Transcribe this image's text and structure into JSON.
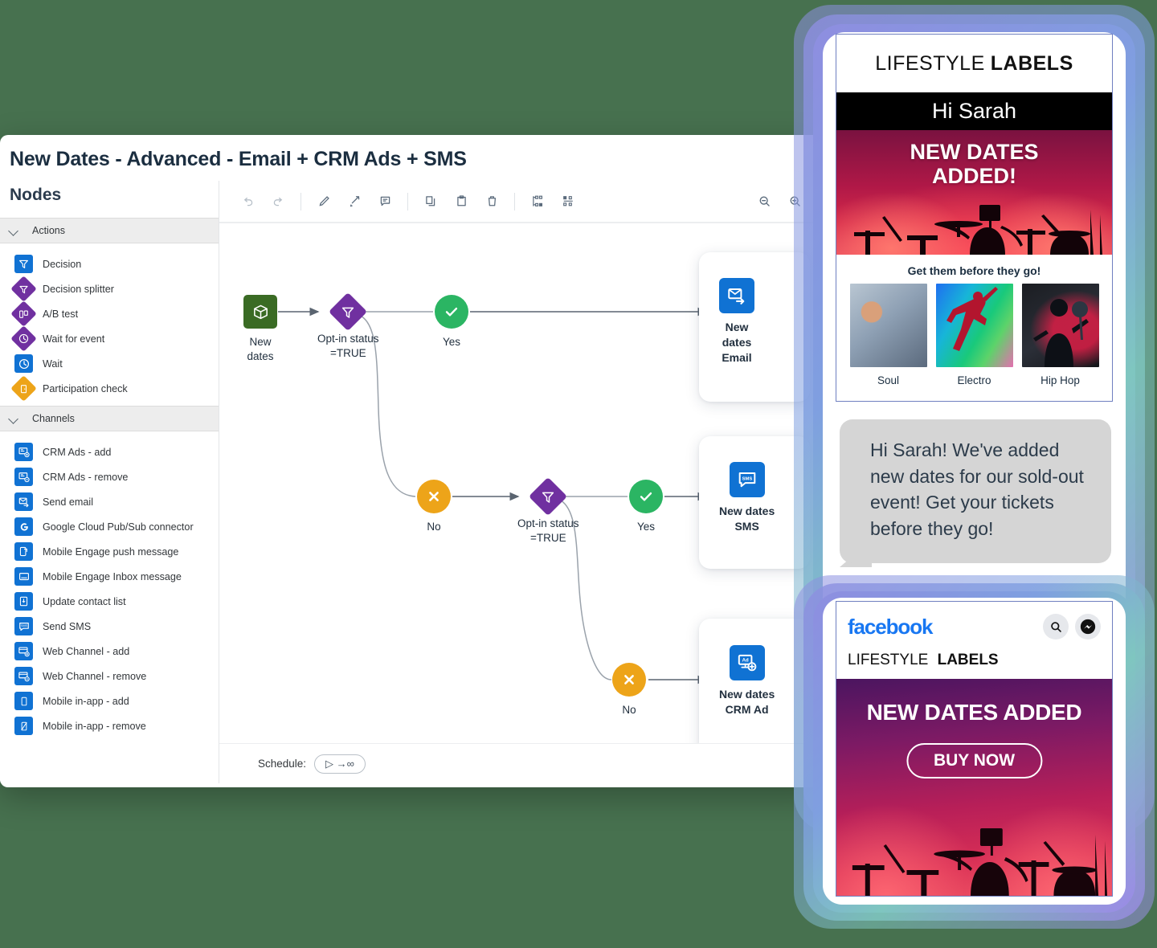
{
  "app": {
    "title": "New Dates - Advanced - Email + CRM Ads + SMS",
    "sidebar_title": "Nodes"
  },
  "sidebar": {
    "groups": [
      {
        "label": "Actions",
        "items": [
          {
            "label": "Decision",
            "icon": "funnel-square-icon",
            "shape": "square-blue"
          },
          {
            "label": "Decision splitter",
            "icon": "funnel-diamond-icon",
            "shape": "diamond-purple"
          },
          {
            "label": "A/B test",
            "icon": "ab-test-icon",
            "shape": "diamond-purple"
          },
          {
            "label": "Wait for event",
            "icon": "clock-icon",
            "shape": "diamond-purple"
          },
          {
            "label": "Wait",
            "icon": "clock-icon",
            "shape": "square-blue"
          },
          {
            "label": "Participation check",
            "icon": "door-icon",
            "shape": "diamond-amber"
          }
        ]
      },
      {
        "label": "Channels",
        "items": [
          {
            "label": "CRM Ads - add",
            "icon": "crm-ads-add-icon",
            "shape": "square-blue"
          },
          {
            "label": "CRM Ads - remove",
            "icon": "crm-ads-remove-icon",
            "shape": "square-blue"
          },
          {
            "label": "Send email",
            "icon": "send-email-icon",
            "shape": "square-blue"
          },
          {
            "label": "Google Cloud Pub/Sub connector",
            "icon": "google-icon",
            "shape": "square-blue"
          },
          {
            "label": "Mobile Engage push message",
            "icon": "push-message-icon",
            "shape": "square-blue"
          },
          {
            "label": "Mobile Engage Inbox message",
            "icon": "inbox-message-icon",
            "shape": "square-blue"
          },
          {
            "label": "Update contact list",
            "icon": "contact-list-icon",
            "shape": "square-blue"
          },
          {
            "label": "Send SMS",
            "icon": "sms-icon",
            "shape": "square-blue"
          },
          {
            "label": "Web Channel - add",
            "icon": "web-channel-add-icon",
            "shape": "square-blue"
          },
          {
            "label": "Web Channel - remove",
            "icon": "web-channel-remove-icon",
            "shape": "square-blue"
          },
          {
            "label": "Mobile in-app - add",
            "icon": "mobile-add-icon",
            "shape": "square-blue"
          },
          {
            "label": "Mobile in-app - remove",
            "icon": "mobile-remove-icon",
            "shape": "square-blue"
          }
        ]
      }
    ]
  },
  "toolbar": {
    "buttons": [
      {
        "name": "undo",
        "icon": "undo-icon"
      },
      {
        "name": "redo",
        "icon": "redo-icon"
      },
      {
        "name": "edit",
        "icon": "pencil-icon"
      },
      {
        "name": "connect",
        "icon": "connector-icon"
      },
      {
        "name": "comment",
        "icon": "comment-icon"
      },
      {
        "name": "copy",
        "icon": "copy-icon"
      },
      {
        "name": "paste",
        "icon": "paste-icon"
      },
      {
        "name": "delete",
        "icon": "trash-icon"
      },
      {
        "name": "auto-layout-vertical",
        "icon": "layout-vertical-icon"
      },
      {
        "name": "auto-layout-horizontal",
        "icon": "layout-horizontal-icon"
      },
      {
        "name": "zoom-out",
        "icon": "zoom-out-icon"
      },
      {
        "name": "zoom-in",
        "icon": "zoom-in-icon"
      }
    ]
  },
  "flow": {
    "nodes": [
      {
        "id": "start",
        "label": "New\ndates",
        "type": "entry",
        "icon": "package-icon"
      },
      {
        "id": "dec1",
        "label": "Opt-in status\n=TRUE",
        "type": "decision",
        "icon": "funnel-icon"
      },
      {
        "id": "yes1",
        "label": "Yes",
        "type": "yes",
        "icon": "check-icon"
      },
      {
        "id": "no1",
        "label": "No",
        "type": "no",
        "icon": "cross-icon"
      },
      {
        "id": "email",
        "label": "New\ndates\nEmail",
        "type": "action",
        "icon": "send-email-icon"
      },
      {
        "id": "dec2",
        "label": "Opt-in status\n=TRUE",
        "type": "decision",
        "icon": "funnel-icon"
      },
      {
        "id": "yes2",
        "label": "Yes",
        "type": "yes",
        "icon": "check-icon"
      },
      {
        "id": "no2",
        "label": "No",
        "type": "no",
        "icon": "cross-icon"
      },
      {
        "id": "sms",
        "label": "New dates\nSMS",
        "type": "action",
        "icon": "sms-icon"
      },
      {
        "id": "crmad",
        "label": "New dates\nCRM Ad",
        "type": "action",
        "icon": "crm-ad-icon"
      }
    ]
  },
  "schedule": {
    "label": "Schedule:",
    "value": "▷ →∞"
  },
  "email_preview": {
    "brand_thin": "LIFESTYLE",
    "brand_bold": "LABELS",
    "greeting": "Hi Sarah",
    "hero_title": "NEW DATES\nADDED!",
    "tagline": "Get them before they go!",
    "thumbs": [
      {
        "caption": "Soul"
      },
      {
        "caption": "Electro"
      },
      {
        "caption": "Hip Hop"
      }
    ]
  },
  "sms_preview": {
    "message": "Hi Sarah! We've added new dates for our sold-out event! Get your tickets before they go!"
  },
  "facebook_preview": {
    "logo": "facebook",
    "brand_thin": "LIFESTYLE",
    "brand_bold": "LABELS",
    "hero_title": "NEW DATES ADDED",
    "cta": "BUY NOW"
  },
  "colors": {
    "page_background": "#47714f",
    "accent_blue": "#1072d3",
    "purple": "#7030a0",
    "green": "#2bb563",
    "amber": "#eda419",
    "entry_green": "#3a6b24",
    "facebook_blue": "#1877f2"
  }
}
